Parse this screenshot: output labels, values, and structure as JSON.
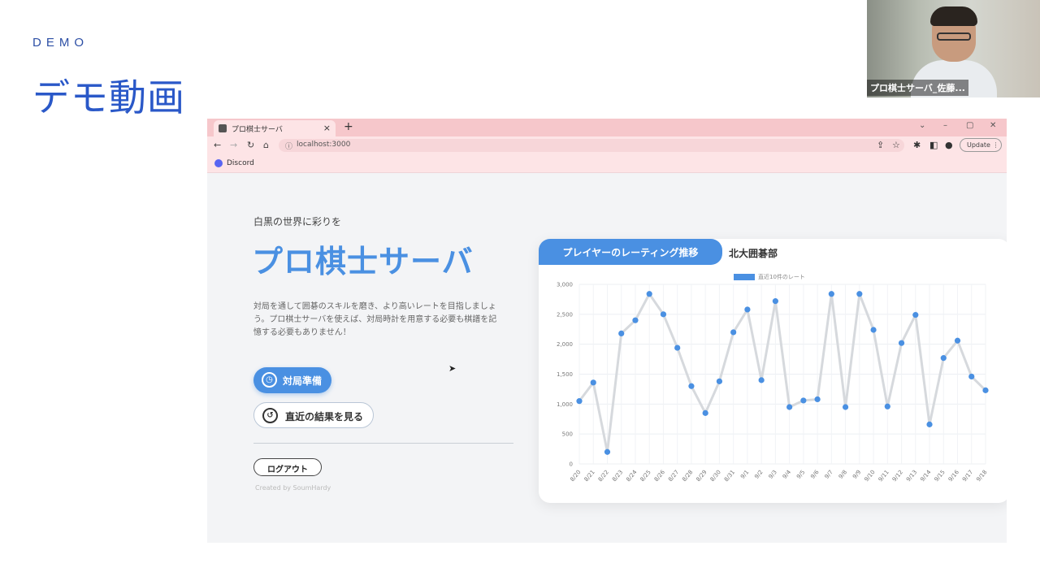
{
  "slide": {
    "section_label": "DEMO",
    "title": "デモ動画"
  },
  "camera": {
    "participant_name": "プロ棋士サーバ_佐藤..."
  },
  "browser": {
    "tab_title": "プロ棋士サーバ",
    "tab_close": "×",
    "new_tab": "+",
    "url": "localhost:3000",
    "update_label": "Update",
    "bookmark_label": "Discord",
    "window_controls": {
      "dropdown": "⌄",
      "minimize": "–",
      "maximize": "▢",
      "close": "✕"
    }
  },
  "page": {
    "tagline": "白黒の世界に彩りを",
    "hero_title": "プロ棋士サーバ",
    "description": "対局を通して囲碁のスキルを磨き、より高いレートを目指しましょう。プロ棋士サーバを使えば、対局時計を用意する必要も棋譜を記憶する必要もありません！",
    "ready_button": "対局準備",
    "recent_button": "直近の結果を見る",
    "logout_button": "ログアウト",
    "credit": "Created by SoumHardy"
  },
  "card": {
    "active_tab": "プレイヤーのレーティング推移",
    "club_tab": "北大囲碁部",
    "legend": "直近10件のレート"
  },
  "colors": {
    "accent": "#4a90e2",
    "tab_bar": "#f6c7cb",
    "title_blue": "#2a58c8"
  },
  "chart_data": {
    "type": "line",
    "x": [
      "8/20",
      "8/21",
      "8/22",
      "8/23",
      "8/24",
      "8/25",
      "8/26",
      "8/27",
      "8/28",
      "8/29",
      "8/30",
      "8/31",
      "9/1",
      "9/2",
      "9/3",
      "9/4",
      "9/5",
      "9/6",
      "9/7",
      "9/8",
      "9/9",
      "9/10",
      "9/11",
      "9/12",
      "9/13",
      "9/14",
      "9/15",
      "9/16",
      "9/17",
      "9/18"
    ],
    "series": [
      {
        "name": "直近10件のレート",
        "values": [
          1050,
          1360,
          200,
          2180,
          2400,
          2840,
          2500,
          1940,
          1300,
          850,
          1380,
          2200,
          2580,
          1400,
          2720,
          950,
          1060,
          1080,
          2840,
          950,
          2840,
          2240,
          960,
          2020,
          2490,
          660,
          1770,
          2060,
          1460,
          1230
        ]
      }
    ],
    "y_ticks": [
      "0",
      "500",
      "1,000",
      "1,500",
      "2,000",
      "2,500",
      "3,000"
    ],
    "ylim": [
      0,
      3000
    ],
    "grid": true,
    "legend_position": "top"
  }
}
